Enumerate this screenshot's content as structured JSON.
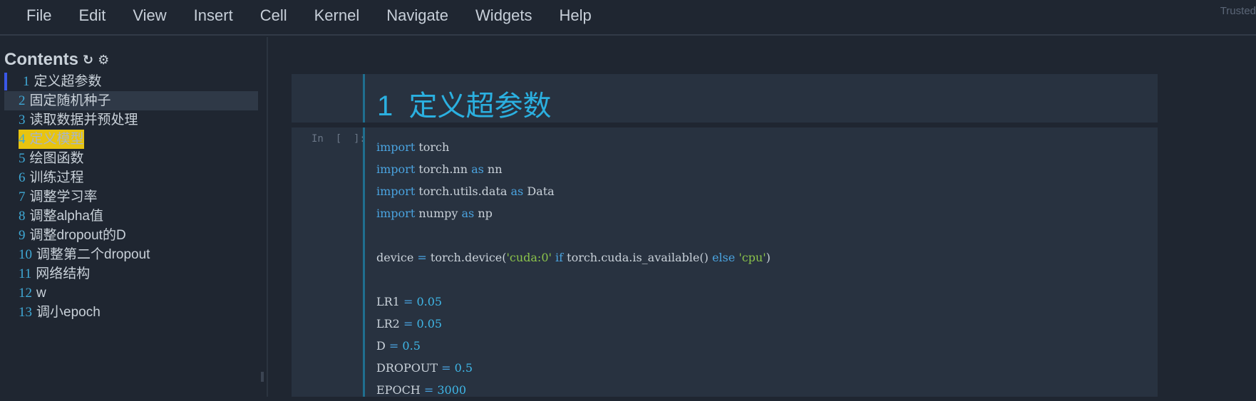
{
  "menubar": {
    "items": [
      "File",
      "Edit",
      "View",
      "Insert",
      "Cell",
      "Kernel",
      "Navigate",
      "Widgets",
      "Help"
    ],
    "trusted": "Trusted"
  },
  "toc": {
    "title": "Contents",
    "icons": [
      "refresh-icon",
      "gear-icon"
    ],
    "items": [
      {
        "num": "1",
        "label": "定义超参数"
      },
      {
        "num": "2",
        "label": "固定随机种子"
      },
      {
        "num": "3",
        "label": "读取数据并预处理"
      },
      {
        "num": "4",
        "label": "定义模型"
      },
      {
        "num": "5",
        "label": "绘图函数"
      },
      {
        "num": "6",
        "label": "训练过程"
      },
      {
        "num": "7",
        "label": "调整学习率"
      },
      {
        "num": "8",
        "label": "调整alpha值"
      },
      {
        "num": "9",
        "label": "调整dropout的D"
      },
      {
        "num": "10",
        "label": "调整第二个dropout"
      },
      {
        "num": "11",
        "label": "网络结构"
      },
      {
        "num": "12",
        "label": "w"
      },
      {
        "num": "13",
        "label": "调小epoch"
      }
    ]
  },
  "notebook": {
    "markdown_cell": {
      "num": "1",
      "heading": "定义超参数"
    },
    "code_cell": {
      "prompt": "In  [  ]:",
      "lines": [
        [
          {
            "t": "kw",
            "v": "import"
          },
          {
            "t": "",
            "v": " torch"
          }
        ],
        [
          {
            "t": "kw",
            "v": "import"
          },
          {
            "t": "",
            "v": " torch.nn "
          },
          {
            "t": "kw",
            "v": "as"
          },
          {
            "t": "",
            "v": " nn"
          }
        ],
        [
          {
            "t": "kw",
            "v": "import"
          },
          {
            "t": "",
            "v": " torch.utils.data "
          },
          {
            "t": "kw",
            "v": "as"
          },
          {
            "t": "",
            "v": " Data"
          }
        ],
        [
          {
            "t": "kw",
            "v": "import"
          },
          {
            "t": "",
            "v": " numpy "
          },
          {
            "t": "kw",
            "v": "as"
          },
          {
            "t": "",
            "v": " np"
          }
        ],
        [],
        [
          {
            "t": "",
            "v": "device "
          },
          {
            "t": "op",
            "v": "="
          },
          {
            "t": "",
            "v": " torch.device("
          },
          {
            "t": "str",
            "v": "'cuda:0'"
          },
          {
            "t": "",
            "v": " "
          },
          {
            "t": "kw",
            "v": "if"
          },
          {
            "t": "",
            "v": " torch.cuda.is_available() "
          },
          {
            "t": "kw",
            "v": "else"
          },
          {
            "t": "",
            "v": " "
          },
          {
            "t": "str",
            "v": "'cpu'"
          },
          {
            "t": "",
            "v": ")"
          }
        ],
        [],
        [
          {
            "t": "",
            "v": "LR1 "
          },
          {
            "t": "op",
            "v": "="
          },
          {
            "t": "",
            "v": " "
          },
          {
            "t": "num2",
            "v": "0.05"
          }
        ],
        [
          {
            "t": "",
            "v": "LR2 "
          },
          {
            "t": "op",
            "v": "="
          },
          {
            "t": "",
            "v": " "
          },
          {
            "t": "num2",
            "v": "0.05"
          }
        ],
        [
          {
            "t": "",
            "v": "D "
          },
          {
            "t": "op",
            "v": "="
          },
          {
            "t": "",
            "v": " "
          },
          {
            "t": "num2",
            "v": "0.5"
          }
        ],
        [
          {
            "t": "",
            "v": "DROPOUT "
          },
          {
            "t": "op",
            "v": "="
          },
          {
            "t": "",
            "v": " "
          },
          {
            "t": "num2",
            "v": "0.5"
          }
        ],
        [
          {
            "t": "",
            "v": "EPOCH "
          },
          {
            "t": "op",
            "v": "="
          },
          {
            "t": "",
            "v": " "
          },
          {
            "t": "num2",
            "v": "3000"
          }
        ]
      ]
    }
  },
  "colors": {
    "background": "#1f2631",
    "cell_background": "#283240",
    "accent": "#2bb0e0",
    "keyword": "#4aa3df",
    "string": "#8bc34a",
    "highlight": "#e8c410"
  }
}
